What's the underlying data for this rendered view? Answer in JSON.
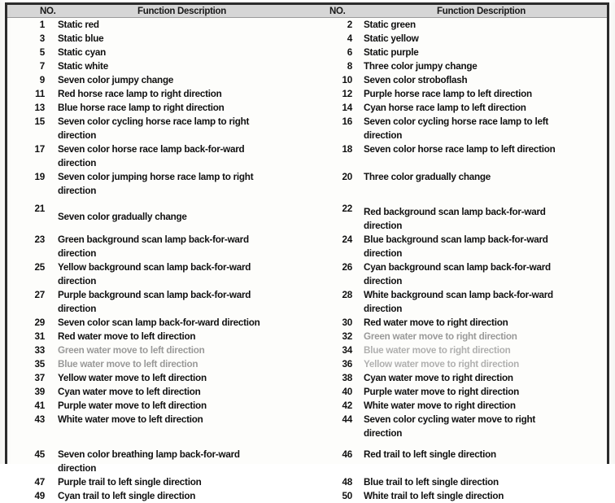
{
  "table": {
    "headers": {
      "no_left": "NO.",
      "desc_left": "Function Description",
      "no_right": "NO.",
      "desc_right": "Function Description"
    },
    "colors": {
      "header_background": "#d6d6d6",
      "page_background": "#fdfdfb",
      "border": "#2c2c2c",
      "text": "#111111",
      "faded_text": "#5d5d5d"
    },
    "rows": [
      {
        "no_left": "1",
        "desc_left": "Static red",
        "no_right": "2",
        "desc_right": "Static green"
      },
      {
        "no_left": "3",
        "desc_left": "Static blue",
        "no_right": "4",
        "desc_right": "Static yellow"
      },
      {
        "no_left": "5",
        "desc_left": "Static cyan",
        "no_right": "6",
        "desc_right": "Static purple"
      },
      {
        "no_left": "7",
        "desc_left": "Static white",
        "no_right": "8",
        "desc_right": "Three color jumpy change"
      },
      {
        "no_left": "9",
        "desc_left": "Seven color jumpy change",
        "no_right": "10",
        "desc_right": "Seven color stroboflash"
      },
      {
        "no_left": "11",
        "desc_left": "Red horse race lamp to right direction",
        "no_right": "12",
        "desc_right": "Purple horse race lamp to left direction"
      },
      {
        "no_left": "13",
        "desc_left": "Blue horse race lamp to right direction",
        "no_right": "14",
        "desc_right": "Cyan horse race lamp to left direction"
      },
      {
        "no_left": "15",
        "desc_left": "Seven color cycling horse race lamp to right",
        "desc_left_cont": "direction",
        "no_right": "16",
        "desc_right": "Seven color cycling horse race lamp to left",
        "desc_right_cont": "direction"
      },
      {
        "no_left": "17",
        "desc_left": "Seven color horse race lamp back-for-ward",
        "desc_left_cont": "direction",
        "no_right": "18",
        "desc_right": "Seven color horse race lamp to left direction"
      },
      {
        "no_left": "19",
        "desc_left": "Seven color jumping horse race lamp to right",
        "desc_left_cont": "direction",
        "no_right": "20",
        "desc_right": "Three color gradually change"
      },
      {
        "no_left": "21",
        "desc_left": "Seven color gradually change",
        "no_right": "22",
        "desc_right": "Red background scan lamp back-for-ward",
        "desc_right_cont": "direction"
      },
      {
        "no_left": "23",
        "desc_left": "Green background scan lamp back-for-ward",
        "desc_left_cont": "direction",
        "no_right": "24",
        "desc_right": "Blue background scan lamp back-for-ward",
        "desc_right_cont": "direction"
      },
      {
        "no_left": "25",
        "desc_left": "Yellow background scan lamp back-for-ward",
        "desc_left_cont": "direction",
        "no_right": "26",
        "desc_right": "Cyan background scan lamp back-for-ward",
        "desc_right_cont": "direction"
      },
      {
        "no_left": "27",
        "desc_left": "Purple background scan lamp back-for-ward",
        "desc_left_cont": "direction",
        "no_right": "28",
        "desc_right": "White background scan lamp back-for-ward",
        "desc_right_cont": "direction"
      },
      {
        "no_left": "29",
        "desc_left": "Seven color scan lamp back-for-ward direction",
        "no_right": "30",
        "desc_right": "Red water move to right direction"
      },
      {
        "no_left": "31",
        "desc_left": "Red water move to left direction",
        "no_right": "32",
        "desc_right": "Green water move to right direction",
        "right_faded": true
      },
      {
        "no_left": "33",
        "desc_left": "Green water move to left direction",
        "left_faded": true,
        "no_right": "34",
        "desc_right": "Blue water move to right direction",
        "right_faded_strong": true
      },
      {
        "no_left": "35",
        "desc_left": "Blue water move to left direction",
        "left_faded": true,
        "no_right": "36",
        "desc_right": "Yellow water move to right direction",
        "right_faded_strong": true
      },
      {
        "no_left": "37",
        "desc_left": "Yellow water move to left direction",
        "no_right": "38",
        "desc_right": "Cyan water move to right direction"
      },
      {
        "no_left": "39",
        "desc_left": "Cyan water move to left direction",
        "no_right": "40",
        "desc_right": "Purple water move to right direction"
      },
      {
        "no_left": "41",
        "desc_left": "Purple water move to left direction",
        "no_right": "42",
        "desc_right": "White water move to right direction"
      },
      {
        "no_left": "43",
        "desc_left": "White water move to left direction",
        "no_right": "44",
        "desc_right": "Seven color cycling water move to right",
        "desc_right_cont": "direction"
      },
      {
        "no_left": "45",
        "desc_left": "Seven color breathing lamp back-for-ward",
        "desc_left_cont": "direction",
        "no_right": "46",
        "desc_right": "Red trail to left single direction"
      },
      {
        "no_left": "47",
        "desc_left": "Purple trail to left single direction",
        "no_right": "48",
        "desc_right": "Blue trail to left single direction"
      },
      {
        "no_left": "49",
        "desc_left": "Cyan trail to left single direction",
        "no_right": "50",
        "desc_right": "White trail to left single direction"
      }
    ]
  }
}
